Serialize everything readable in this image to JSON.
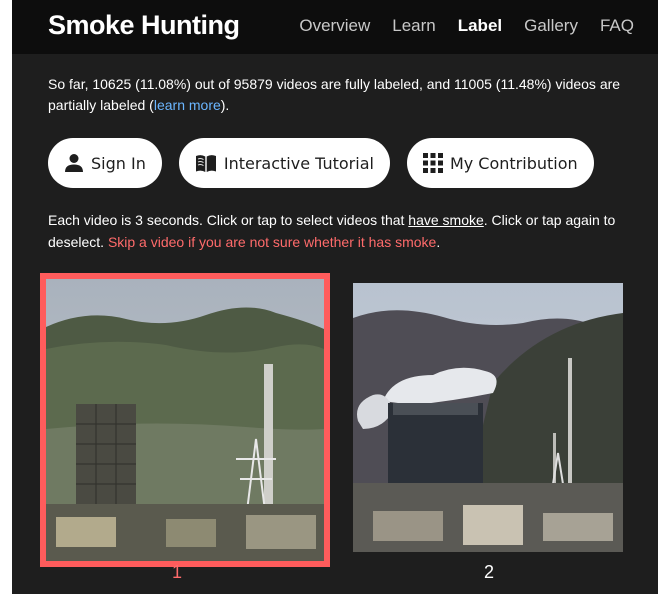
{
  "nav": {
    "brand": "Smoke Hunting",
    "links": [
      "Overview",
      "Learn",
      "Label",
      "Gallery",
      "FAQ"
    ],
    "active": "Label"
  },
  "stats": {
    "part1": "So far, 10625 (11.08%) out of 95879 videos are fully labeled, and 11005 (11.48%) videos are partially labeled (",
    "link": "learn more",
    "part2": ")."
  },
  "buttons": {
    "sign_in": "Sign In",
    "tutorial": "Interactive Tutorial",
    "contribution": "My Contribution"
  },
  "instructions": {
    "part1": "Each video is 3 seconds. Click or tap to select videos that ",
    "underlined": "have smoke",
    "part2": ". Click or tap again to deselect. ",
    "warning": "Skip a video if you are not sure whether it has smoke",
    "part3": "."
  },
  "videos": [
    {
      "label": "1",
      "selected": true
    },
    {
      "label": "2",
      "selected": false
    }
  ],
  "colors": {
    "selected": "#ff5c5c",
    "warning": "#ff6b6b",
    "link": "#6bb6ff",
    "background": "#1e1e1e",
    "navbar": "#0d0d0d"
  },
  "icons": [
    "user-icon",
    "book-icon",
    "grid-icon"
  ]
}
